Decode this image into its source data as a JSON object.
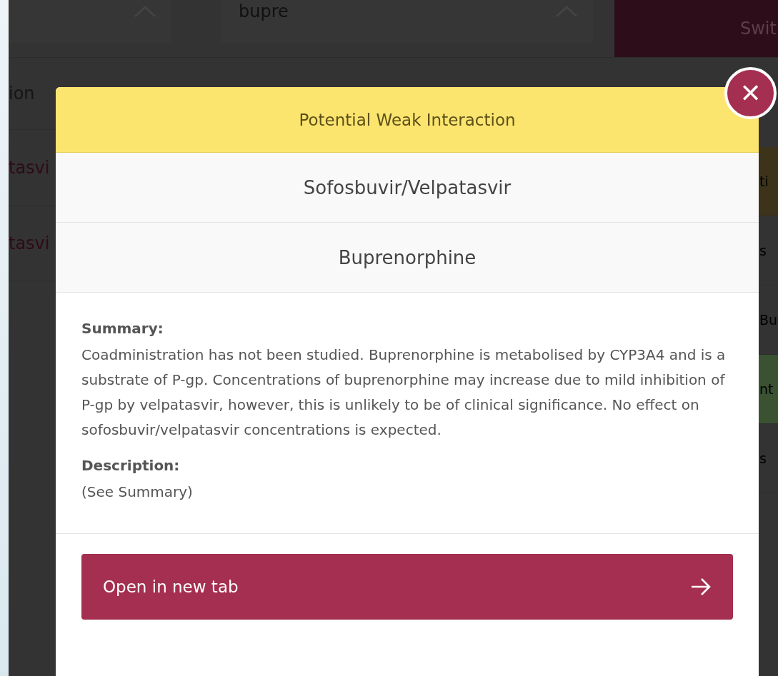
{
  "background_page": {
    "search_field": {
      "value": "bupre"
    },
    "switch_button": "Swit",
    "left_column": [
      "ion",
      "tasvi",
      "tasvi"
    ],
    "right_column": [
      {
        "text": "ti",
        "color": "#3d331b"
      },
      {
        "text": "s",
        "color": "#333333"
      },
      {
        "text": "Bu",
        "color": "#333333"
      },
      {
        "text": "nt",
        "color": "#3a5232"
      },
      {
        "text": "s",
        "color": "#333333"
      }
    ]
  },
  "modal": {
    "title": "Potential Weak Interaction",
    "close_button": "✕",
    "drugs": [
      "Sofosbuvir/Velpatasvir",
      "Buprenorphine"
    ],
    "sections": [
      {
        "heading": "Summary:",
        "text": "Coadministration has not been studied. Buprenorphine is metabolised by CYP3A4 and is a substrate of P-gp. Concentrations of buprenorphine may increase due to mild inhibition of P-gp by velpatasvir, however, this is unlikely to be of clinical significance. No effect on sofosbuvir/velpatasvir concentrations is expected."
      },
      {
        "heading": "Description:",
        "text": "(See Summary)"
      }
    ],
    "action_button": "Open in new tab"
  }
}
